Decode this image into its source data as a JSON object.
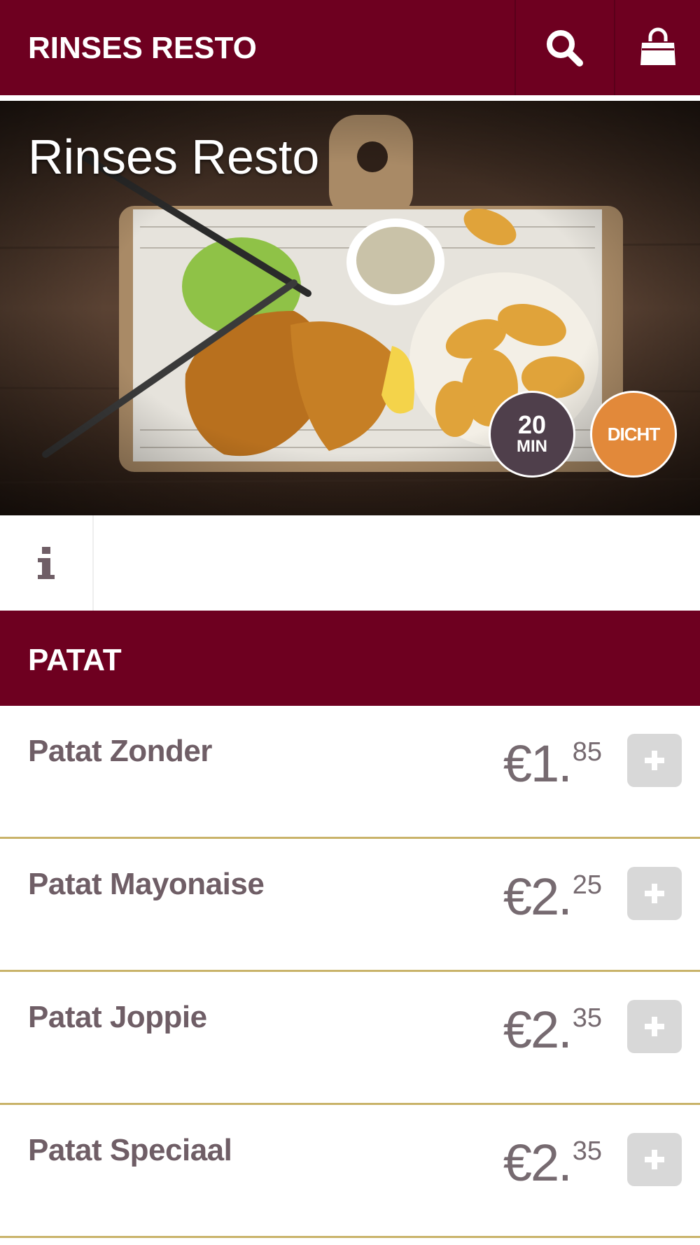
{
  "header": {
    "brand": "RINSES RESTO",
    "search_icon": "search-icon",
    "cart_icon": "shopping-bag-icon"
  },
  "hero": {
    "title": "Rinses Resto",
    "delivery_time": {
      "value": "20",
      "unit": "MIN"
    },
    "status": "DICHT"
  },
  "info_tab": {
    "icon": "info-icon"
  },
  "category": {
    "label": "PATAT"
  },
  "menu": {
    "items": [
      {
        "name": "Patat Zonder",
        "price_main": "€1.",
        "price_cents": "85"
      },
      {
        "name": "Patat Mayonaise",
        "price_main": "€2.",
        "price_cents": "25"
      },
      {
        "name": "Patat Joppie",
        "price_main": "€2.",
        "price_cents": "35"
      },
      {
        "name": "Patat Speciaal",
        "price_main": "€2.",
        "price_cents": "35"
      }
    ],
    "add_icon": "plus-icon"
  },
  "colors": {
    "brand": "#6e0020",
    "badge_time": "#4f3f4b",
    "badge_status": "#e2893a",
    "divider": "#c9b36a",
    "item_text": "#6f5e66",
    "add_button": "#d8d8d8"
  }
}
